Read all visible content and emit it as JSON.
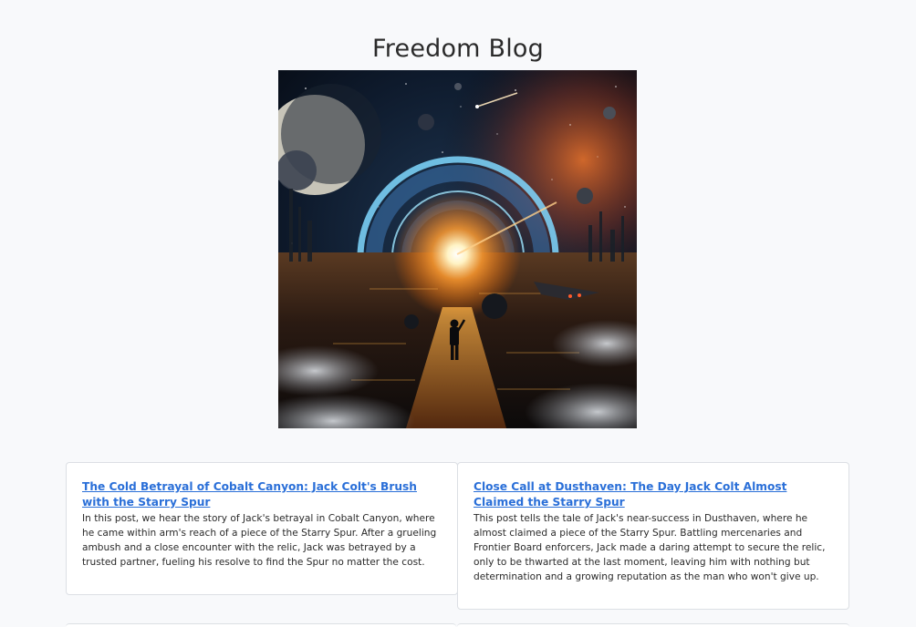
{
  "site": {
    "title": "Freedom Blog"
  },
  "hero": {
    "icon": "space-portal-illustration"
  },
  "posts": [
    {
      "title": "The Cold Betrayal of Cobalt Canyon: Jack Colt's Brush with the Starry Spur",
      "summary": "In this post, we hear the story of Jack's betrayal in Cobalt Canyon, where he came within arm's reach of a piece of the Starry Spur. After a grueling ambush and a close encounter with the relic, Jack was betrayed by a trusted partner, fueling his resolve to find the Spur no matter the cost."
    },
    {
      "title": "Close Call at Dusthaven: The Day Jack Colt Almost Claimed the Starry Spur",
      "summary": "This post tells the tale of Jack's near-success in Dusthaven, where he almost claimed a piece of the Starry Spur. Battling mercenaries and Frontier Board enforcers, Jack made a daring attempt to secure the relic, only to be thwarted at the last moment, leaving him with nothing but determination and a growing reputation as the man who won't give up."
    }
  ],
  "colors": {
    "link": "#2a6fd8",
    "background": "#f8f9fb",
    "card_border": "#dcdfe4"
  }
}
